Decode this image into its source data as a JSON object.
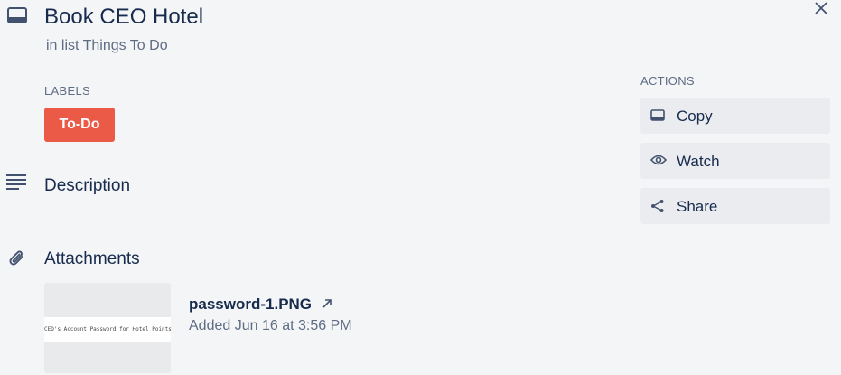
{
  "card": {
    "title": "Book CEO Hotel",
    "list_text": "in list Things To Do"
  },
  "labels": {
    "heading": "LABELS",
    "items": [
      {
        "text": "To-Do",
        "color": "#eb5a46"
      }
    ]
  },
  "description": {
    "title": "Description"
  },
  "attachments": {
    "title": "Attachments",
    "items": [
      {
        "filename": "password-1.PNG",
        "added": "Added Jun 16 at 3:56 PM",
        "thumbnail_text": "CEO's Account Password for Hotel Points"
      }
    ]
  },
  "actions": {
    "heading": "ACTIONS",
    "buttons": [
      {
        "label": "Copy",
        "icon": "card-icon"
      },
      {
        "label": "Watch",
        "icon": "eye-icon"
      },
      {
        "label": "Share",
        "icon": "share-icon"
      }
    ]
  },
  "icons": {
    "card": "card-icon",
    "close": "close-icon",
    "description": "description-icon",
    "attachment": "paperclip-icon",
    "external": "external-link-icon"
  },
  "colors": {
    "background": "#f4f5f7",
    "label_red": "#eb5a46",
    "text_primary": "#172b4d",
    "text_secondary": "#5e6c84",
    "button_bg": "#ebecf0"
  }
}
